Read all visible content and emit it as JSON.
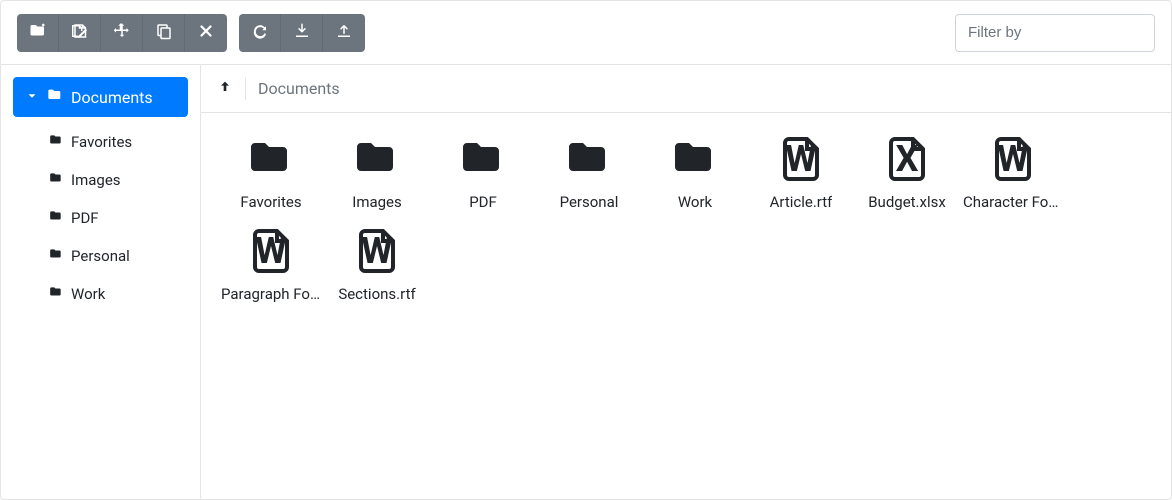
{
  "toolbar": {
    "filter_placeholder": "Filter by"
  },
  "tree": {
    "root": "Documents",
    "children": [
      "Favorites",
      "Images",
      "PDF",
      "Personal",
      "Work"
    ]
  },
  "breadcrumb": {
    "current": "Documents"
  },
  "items": [
    {
      "type": "folder",
      "name": "Favorites"
    },
    {
      "type": "folder",
      "name": "Images"
    },
    {
      "type": "folder",
      "name": "PDF"
    },
    {
      "type": "folder",
      "name": "Personal"
    },
    {
      "type": "folder",
      "name": "Work"
    },
    {
      "type": "file",
      "name": "Article.rtf",
      "letter": "W"
    },
    {
      "type": "file",
      "name": "Budget.xlsx",
      "letter": "X"
    },
    {
      "type": "file",
      "name": "Character Formatting.docx",
      "letter": "W"
    },
    {
      "type": "file",
      "name": "Paragraph Formatting.docx",
      "letter": "W"
    },
    {
      "type": "file",
      "name": "Sections.rtf",
      "letter": "W"
    }
  ]
}
